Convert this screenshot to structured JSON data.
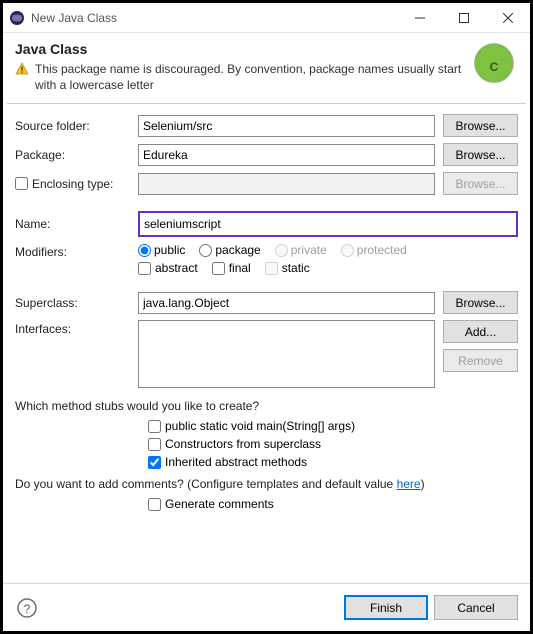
{
  "window": {
    "title": "New Java Class"
  },
  "header": {
    "title": "Java Class",
    "warning": "This package name is discouraged. By convention, package names usually start with a lowercase letter"
  },
  "labels": {
    "sourceFolder": "Source folder:",
    "package": "Package:",
    "enclosingType": "Enclosing type:",
    "name": "Name:",
    "modifiers": "Modifiers:",
    "superclass": "Superclass:",
    "interfaces": "Interfaces:"
  },
  "fields": {
    "sourceFolder": "Selenium/src",
    "package": "Edureka",
    "enclosingType": "",
    "name": "seleniumscript",
    "superclass": "java.lang.Object"
  },
  "buttons": {
    "browse": "Browse...",
    "add": "Add...",
    "remove": "Remove",
    "finish": "Finish",
    "cancel": "Cancel"
  },
  "modifiers": {
    "public": "public",
    "package": "package",
    "private": "private",
    "protected": "protected",
    "abstract": "abstract",
    "final": "final",
    "static": "static"
  },
  "stubs": {
    "question": "Which method stubs would you like to create?",
    "main": "public static void main(String[] args)",
    "constructors": "Constructors from superclass",
    "inherited": "Inherited abstract methods"
  },
  "comments": {
    "question_pre": "Do you want to add comments? (Configure templates and default value ",
    "link": "here",
    "question_post": ")",
    "generate": "Generate comments"
  }
}
